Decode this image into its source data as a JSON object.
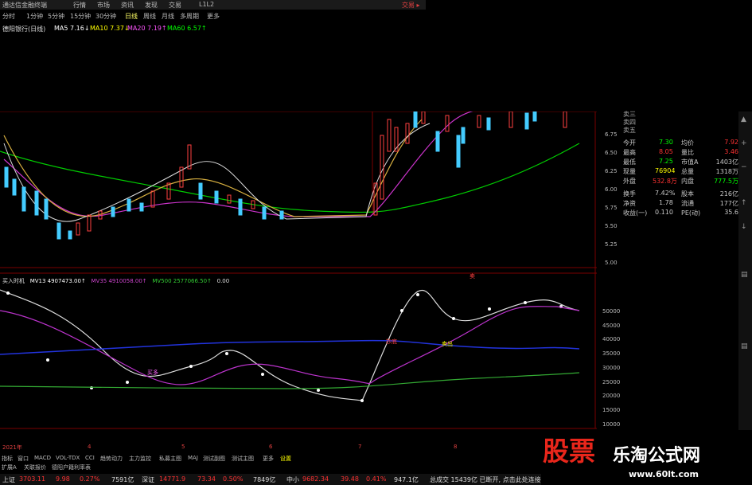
{
  "topbar": {
    "items": [
      "通达信金融终端",
      "行情",
      "市场",
      "资讯",
      "发现",
      "交易",
      "L1L2"
    ],
    "right": "交易 ▸"
  },
  "periods": {
    "items": [
      "分时",
      "1分钟",
      "5分钟",
      "15分钟",
      "30分钟",
      "日线",
      "周线",
      "月线",
      "多周期",
      "更多"
    ],
    "active_index": 5
  },
  "stock_label": "德阳银行(日线)",
  "ma": [
    {
      "label": "MA5",
      "value": "7.16↓",
      "color": "#ffffff"
    },
    {
      "label": "MA10",
      "value": "7.37↓",
      "color": "#ffff00"
    },
    {
      "label": "MA20",
      "value": "7.19↑",
      "color": "#ff55ff"
    },
    {
      "label": "MA60",
      "value": "6.57↑",
      "color": "#00ff00"
    }
  ],
  "price_axis": [
    "6.75",
    "6.50",
    "6.25",
    "6.00",
    "5.75",
    "5.50",
    "5.25",
    "5.00"
  ],
  "vol_axis": [
    "50000",
    "45000",
    "40000",
    "35000",
    "30000",
    "25000",
    "20000",
    "15000",
    "10000"
  ],
  "volume_label": {
    "title": "买入时机",
    "mv13": "MV13  4907473.00↑",
    "mv35": "MV35  4910058.00↑",
    "mv500": "MV500  2577066.50↑",
    "extra": "0.00"
  },
  "annotations": {
    "buy": "买多",
    "sell": "卖出",
    "lbl": "卖",
    "red": "抄底"
  },
  "panel": {
    "asks": [
      "卖三",
      "卖四",
      "卖五"
    ],
    "rows": [
      {
        "l1": "今开",
        "v1": "7.30",
        "l2": "均价",
        "v2": "7.92",
        "c1": "#00ff00",
        "c2": "#ff3333"
      },
      {
        "l1": "最高",
        "v1": "8.05",
        "l2": "量比",
        "v2": "3.46",
        "c1": "#ff3333",
        "c2": "#ff3333"
      },
      {
        "l1": "最低",
        "v1": "7.25",
        "l2": "市值A",
        "v2": "1403亿",
        "c1": "#00ff00",
        "c2": "#cccccc"
      },
      {
        "l1": "现量",
        "v1": "76904",
        "l2": "总量",
        "v2": "1318万",
        "c1": "#ffff00",
        "c2": "#cccccc"
      },
      {
        "l1": "外盘",
        "v1": "532.8万",
        "l2": "内盘",
        "v2": "777.5万",
        "c1": "#ff3333",
        "c2": "#00ff00"
      },
      {
        "l1": "换手",
        "v1": "7.42%",
        "l2": "股本",
        "v2": "216亿",
        "c1": "#cccccc",
        "c2": "#cccccc"
      },
      {
        "l1": "净资",
        "v1": "1.78",
        "l2": "流通",
        "v2": "177亿",
        "c1": "#cccccc",
        "c2": "#cccccc"
      },
      {
        "l1": "收益(一)",
        "v1": "0.110",
        "l2": "PE(动)",
        "v2": "35.6",
        "c1": "#cccccc",
        "c2": "#cccccc"
      }
    ]
  },
  "time_axis": [
    "2021年",
    "4",
    "5",
    "6",
    "7",
    "8"
  ],
  "tabs": [
    "指标",
    "窗口",
    "MACD",
    "VOL-TDX",
    "CCI",
    "趋势动力",
    "主力监控",
    "私募主图",
    "MAJ",
    "测试副图",
    "测试主图",
    "更多",
    "设置"
  ],
  "tabs2": [
    "扩展A",
    "关联报价",
    "德阳户籍利率表"
  ],
  "status": [
    {
      "label": "上证",
      "value": "3703.11",
      "chg": "9.98",
      "pct": "0.27%",
      "amt": "7591亿"
    },
    {
      "label": "深证",
      "value": "14771.9",
      "chg": "73.34",
      "pct": "0.50%",
      "amt": "7849亿"
    },
    {
      "label": "中小",
      "value": "9682.34",
      "chg": "39.48",
      "pct": "0.41%",
      "amt": "947.1亿"
    }
  ],
  "status_tail": "总成交  15439亿  已断开, 点击此处连接",
  "watermark": {
    "big": "股票",
    "mid": "乐淘公式网",
    "url": "www.60lt.com"
  }
}
